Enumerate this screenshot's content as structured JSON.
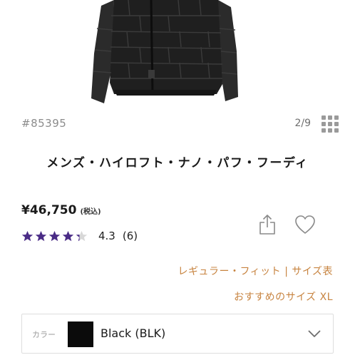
{
  "product": {
    "id": "#85395",
    "title": "メンズ・ハイロフト・ナノ・パフ・フーディ",
    "price": "¥46,750",
    "tax_note": "(税込)",
    "rating": {
      "value": "4.3",
      "count": "(6)",
      "stars": 4.3,
      "max_stars": 5
    }
  },
  "gallery": {
    "counter": "2/9",
    "grid_icon": "grid-icon"
  },
  "actions": {
    "share_icon": "share-icon",
    "favorite_icon": "heart-icon"
  },
  "size_links": {
    "fit": "レギュラー・フィット",
    "separator": "|",
    "size_chart": "サイズ表",
    "recommended": "おすすめのサイズ XL"
  },
  "color_selector": {
    "label": "カラー",
    "value": "Black (BLK)",
    "swatch_color": "#0b0b0b"
  },
  "colors": {
    "accent": "#c7833f",
    "star": "#4a2c86",
    "muted": "#8c8c8c"
  }
}
